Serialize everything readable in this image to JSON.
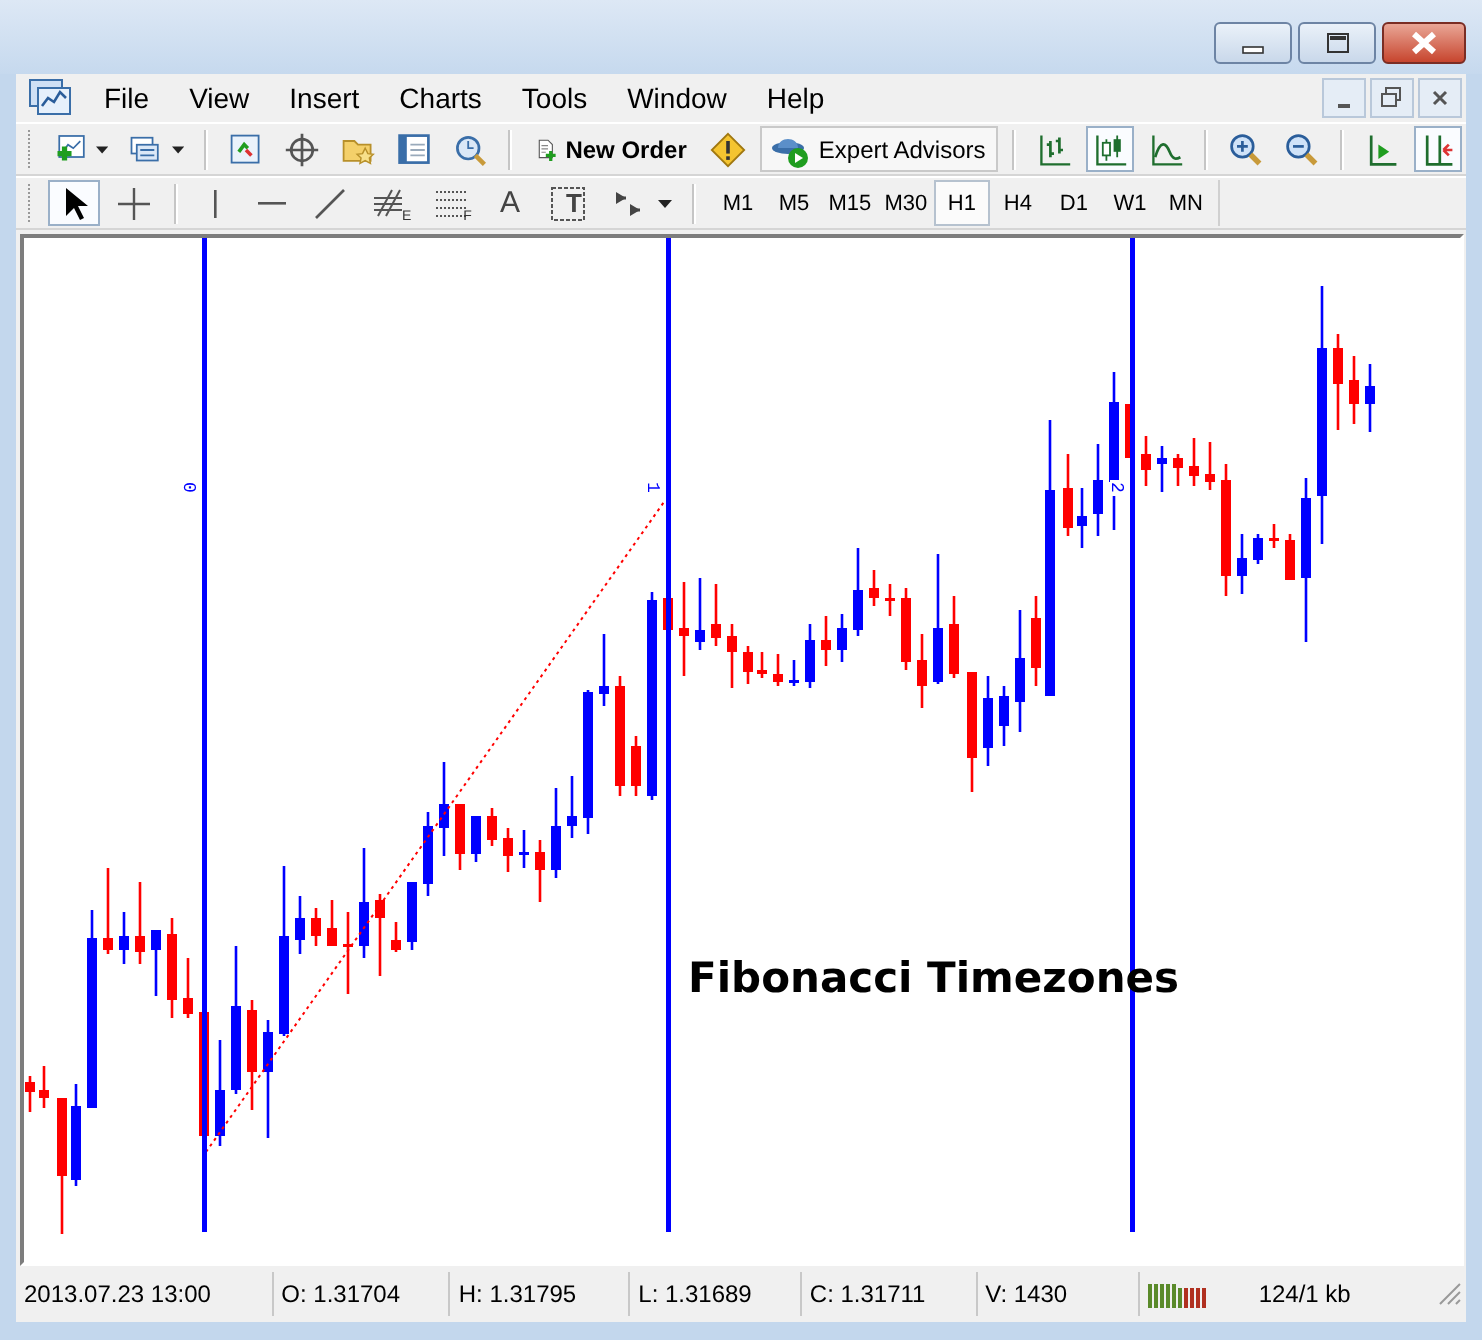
{
  "window": {
    "controls": [
      {
        "kind": "minimize"
      },
      {
        "kind": "maximize"
      },
      {
        "kind": "close"
      }
    ]
  },
  "menu_bar": {
    "items": [
      "File",
      "View",
      "Insert",
      "Charts",
      "Tools",
      "Window",
      "Help"
    ],
    "mdi_controls": [
      {
        "kind": "minimize"
      },
      {
        "kind": "restore"
      },
      {
        "kind": "close"
      }
    ]
  },
  "standard_toolbar": {
    "items": [
      {
        "kind": "new-chart",
        "dropdown": true
      },
      {
        "kind": "profiles",
        "dropdown": true
      },
      {
        "kind": "separator"
      },
      {
        "kind": "market-watch"
      },
      {
        "kind": "crosshair-target"
      },
      {
        "kind": "navigator"
      },
      {
        "kind": "terminal"
      },
      {
        "kind": "tester"
      },
      {
        "kind": "separator"
      },
      {
        "kind": "new-order",
        "label": "New Order"
      },
      {
        "kind": "alert"
      },
      {
        "kind": "expert-advisors",
        "label": "Expert Advisors"
      },
      {
        "kind": "separator"
      },
      {
        "kind": "bar-chart",
        "pressed": false
      },
      {
        "kind": "candlesticks",
        "pressed": true
      },
      {
        "kind": "line-chart",
        "pressed": false
      },
      {
        "kind": "separator"
      },
      {
        "kind": "zoom-in"
      },
      {
        "kind": "zoom-out"
      },
      {
        "kind": "separator"
      },
      {
        "kind": "auto-scroll",
        "pressed": false
      },
      {
        "kind": "chart-shift",
        "pressed": true
      }
    ]
  },
  "drawing_toolbar": {
    "items": [
      {
        "kind": "cursor",
        "pressed": true
      },
      {
        "kind": "crosshair",
        "pressed": false
      },
      {
        "kind": "separator"
      },
      {
        "kind": "vertical-line",
        "pressed": false
      },
      {
        "kind": "horizontal-line",
        "pressed": false
      },
      {
        "kind": "trend-line",
        "pressed": false
      },
      {
        "kind": "hatch",
        "glyph": "E",
        "pressed": false
      },
      {
        "kind": "dotted",
        "glyph": "F",
        "pressed": false
      },
      {
        "kind": "text",
        "glyph": "A",
        "pressed": false
      },
      {
        "kind": "text-label",
        "glyph": "T",
        "pressed": false
      },
      {
        "kind": "arrows",
        "dropdown": true,
        "pressed": false
      }
    ],
    "timeframes": [
      {
        "label": "M1",
        "selected": false
      },
      {
        "label": "M5",
        "selected": false
      },
      {
        "label": "M15",
        "selected": false
      },
      {
        "label": "M30",
        "selected": false
      },
      {
        "label": "H1",
        "selected": true
      },
      {
        "label": "H4",
        "selected": false
      },
      {
        "label": "D1",
        "selected": false
      },
      {
        "label": "W1",
        "selected": false
      },
      {
        "label": "MN",
        "selected": false
      }
    ]
  },
  "chart": {
    "zones": [
      {
        "label": "0"
      },
      {
        "label": "1"
      },
      {
        "label": "2"
      }
    ],
    "annotation": "Fibonacci Timezones"
  },
  "status_bar": {
    "cells": [
      "2013.07.23 13:00",
      "O: 1.31704",
      "H: 1.31795",
      "L: 1.31689",
      "C: 1.31711",
      "V: 1430"
    ],
    "traffic": "124/1 kb"
  }
}
